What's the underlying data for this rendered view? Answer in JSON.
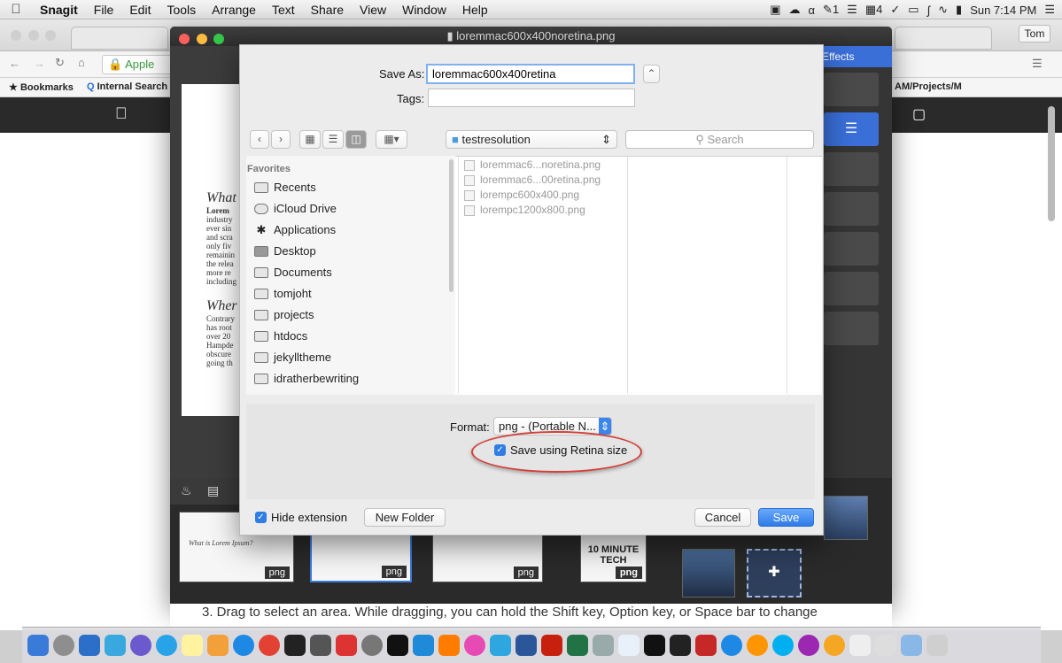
{
  "menubar": {
    "app": "Snagit",
    "items": [
      "File",
      "Edit",
      "Tools",
      "Arrange",
      "Text",
      "Share",
      "View",
      "Window",
      "Help"
    ],
    "status": {
      "badge1": "1",
      "badge2": "4",
      "clock": "Sun 7:14 PM"
    }
  },
  "chrome": {
    "tab_user": "Tom",
    "address_text": "Apple Inc",
    "bookmarks_label": "Bookmarks",
    "internal_search": "Internal Search",
    "path_fragment": "AM/Projects/M"
  },
  "snagit": {
    "title": "loremmac600x400noretina.png",
    "effects_label": "Effects",
    "canvas_heading1": "What",
    "canvas_heading2": "Wher",
    "canvas_lines1": [
      "Lorem",
      "industry",
      "ever sin",
      "and scra",
      "only fiv",
      "remainin",
      "the relea",
      "more re",
      "including"
    ],
    "canvas_lines2": [
      "Contrary",
      "has root",
      "over 20",
      "Hampde",
      "obscure",
      "going th"
    ],
    "thumbs": [
      {
        "badge": "png",
        "text": "What is Lorem Ipsum?"
      },
      {
        "badge": "png",
        "text": ""
      },
      {
        "badge": "png",
        "text": ""
      },
      {
        "badge": "png",
        "text": "10 MINUTE TECH"
      }
    ],
    "caption": "3. Drag to select an area. While dragging, you can hold the Shift key, Option key, or Space bar to change"
  },
  "dialog": {
    "save_as_label": "Save As:",
    "save_as_value": "loremmac600x400retina",
    "tags_label": "Tags:",
    "tags_value": "",
    "location": "testresolution",
    "search_placeholder": "Search",
    "favorites_label": "Favorites",
    "sidebar": [
      {
        "label": "Recents",
        "icon": "recents-icon"
      },
      {
        "label": "iCloud Drive",
        "icon": "cloud-icon"
      },
      {
        "label": "Applications",
        "icon": "applications-icon"
      },
      {
        "label": "Desktop",
        "icon": "desktop-icon"
      },
      {
        "label": "Documents",
        "icon": "documents-icon"
      },
      {
        "label": "tomjoht",
        "icon": "home-icon"
      },
      {
        "label": "projects",
        "icon": "folder-icon"
      },
      {
        "label": "htdocs",
        "icon": "folder-icon"
      },
      {
        "label": "jekylltheme",
        "icon": "folder-icon"
      },
      {
        "label": "idratherbewriting",
        "icon": "folder-icon"
      }
    ],
    "files": [
      "loremmac6...noretina.png",
      "loremmac6...00retina.png",
      "lorempc600x400.png",
      "lorempc1200x800.png"
    ],
    "format_label": "Format:",
    "format_value": "png - (Portable N...",
    "retina_label": "Save using Retina size",
    "hide_ext_label": "Hide extension",
    "new_folder_label": "New Folder",
    "cancel_label": "Cancel",
    "save_label": "Save"
  },
  "colors": {
    "accent": "#2f7be8",
    "highlight_ring": "#d3413a",
    "effects_tab": "#3a6fd8"
  }
}
